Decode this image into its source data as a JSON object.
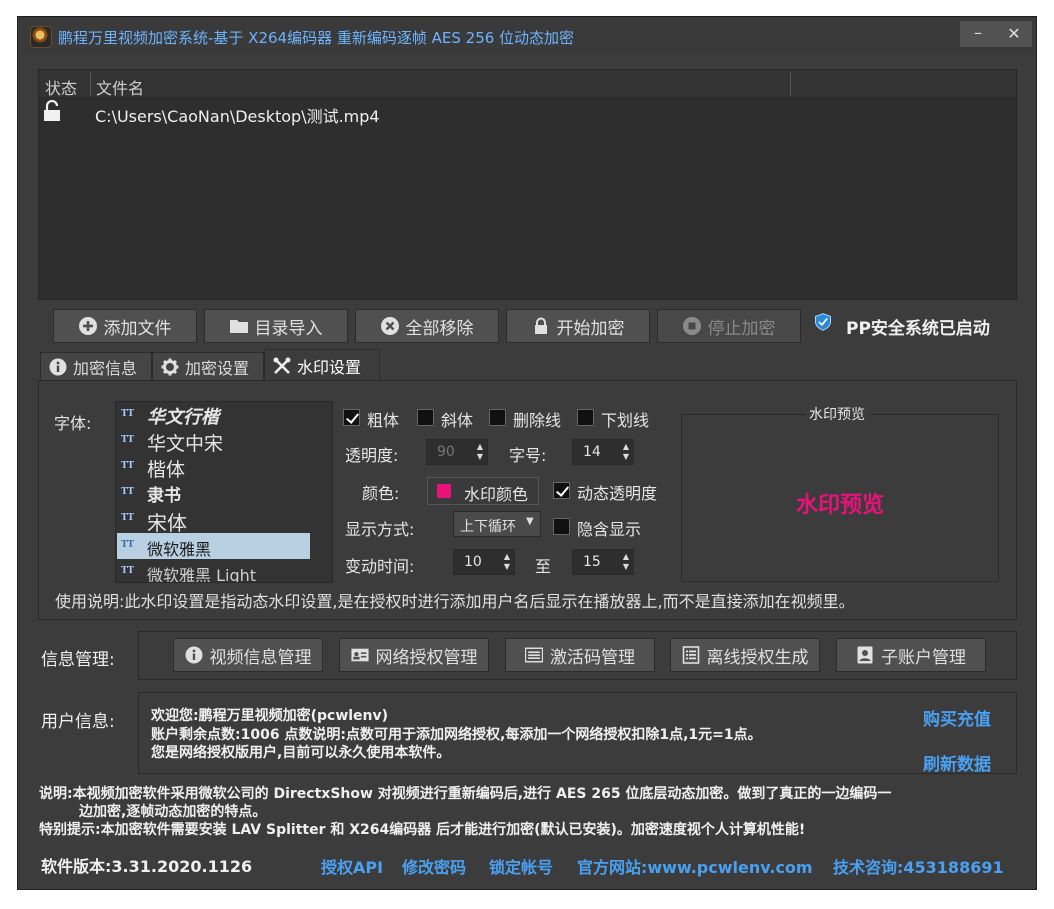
{
  "window": {
    "title": "鹏程万里视频加密系统-基于 X264编码器 重新编码逐帧 AES 256 位动态加密",
    "minimize_glyph": "–",
    "close_glyph": "✕"
  },
  "file_list": {
    "columns": [
      "状态",
      "文件名"
    ],
    "rows": [
      {
        "status_icon": "unlock-icon",
        "filename": "C:\\Users\\CaoNan\\Desktop\\测试.mp4"
      }
    ]
  },
  "toolbar": {
    "add_file": "添加文件",
    "import_dir": "目录导入",
    "remove_all": "全部移除",
    "start_encrypt": "开始加密",
    "stop_encrypt": "停止加密",
    "pp_status": "PP安全系统已启动"
  },
  "tabs": {
    "encrypt_info": "加密信息",
    "encrypt_settings": "加密设置",
    "watermark_settings": "水印设置",
    "active": "watermark_settings"
  },
  "watermark": {
    "font_label": "字体:",
    "fonts": [
      "华文行楷",
      "华文中宋",
      "楷体",
      "隶书",
      "宋体",
      "微软雅黑",
      "微软雅黑 Light"
    ],
    "selected_font": "微软雅黑",
    "bold": {
      "label": "粗体",
      "checked": true
    },
    "italic": {
      "label": "斜体",
      "checked": false
    },
    "strikethrough": {
      "label": "删除线",
      "checked": false
    },
    "underline": {
      "label": "下划线",
      "checked": false
    },
    "opacity_label": "透明度:",
    "opacity_value": "90",
    "font_size_label": "字号:",
    "font_size_value": "14",
    "color_label": "颜色:",
    "color_button": "水印颜色",
    "color_value": "#e8127a",
    "dynamic_opacity": {
      "label": "动态透明度",
      "checked": true
    },
    "display_mode_label": "显示方式:",
    "display_mode_value": "上下循环",
    "hidden_display": {
      "label": "隐含显示",
      "checked": false
    },
    "change_time_label": "变动时间:",
    "change_time_from": "10",
    "change_time_to_label": "至",
    "change_time_to": "15",
    "preview_title": "水印预览",
    "preview_text": "水印预览",
    "usage_note": "使用说明:此水印设置是指动态水印设置,是在授权时进行添加用户名后显示在播放器上,而不是直接添加在视频里。"
  },
  "info_management": {
    "label": "信息管理:",
    "buttons": {
      "video_info": "视频信息管理",
      "network_auth": "网络授权管理",
      "activation_code": "激活码管理",
      "offline_auth": "离线授权生成",
      "sub_account": "子账户管理"
    }
  },
  "user_info": {
    "label": "用户信息:",
    "line1": "欢迎您:鹏程万里视频加密(pcwlenv)",
    "line2": "账户剩余点数:1006    点数说明:点数可用于添加网络授权,每添加一个网络授权扣除1点,1元=1点。",
    "line3": "您是网络授权版用户,目前可以永久使用本软件。",
    "buy_recharge": "购买充值",
    "refresh_data": "刷新数据"
  },
  "notes": {
    "line1": "说明:本视频加密软件采用微软公司的 DirectxShow 对视频进行重新编码后,进行 AES 265 位底层动态加密。做到了真正的一边编码一",
    "line2": "边加密,逐帧动态加密的特点。",
    "line3": "特别提示:本加密软件需要安装 LAV Splitter 和 X264编码器 后才能进行加密(默认已安装)。加密速度视个人计算机性能!"
  },
  "footer": {
    "version": "软件版本:3.31.2020.1126",
    "auth_api": "授权API",
    "change_password": "修改密码",
    "lock_account": "锁定帐号",
    "website": "官方网站:www.pcwlenv.com",
    "support": "技术咨询:453188691"
  }
}
